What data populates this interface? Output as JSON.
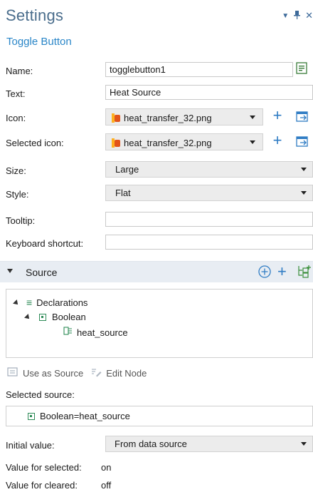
{
  "header": {
    "title": "Settings",
    "subtitle": "Toggle Button"
  },
  "window_controls": [
    "chevron-down-icon",
    "pin-icon",
    "close-icon"
  ],
  "fields": {
    "name": {
      "label": "Name:",
      "value": "togglebutton1"
    },
    "text": {
      "label": "Text:",
      "value": "Heat Source"
    },
    "icon": {
      "label": "Icon:",
      "value": "heat_transfer_32.png"
    },
    "selected_icon": {
      "label": "Selected icon:",
      "value": "heat_transfer_32.png"
    },
    "size": {
      "label": "Size:",
      "value": "Large"
    },
    "style": {
      "label": "Style:",
      "value": "Flat"
    },
    "tooltip": {
      "label": "Tooltip:",
      "value": ""
    },
    "keyboard_shortcut": {
      "label": "Keyboard shortcut:",
      "value": ""
    }
  },
  "source_section": {
    "title": "Source",
    "tree": {
      "root": "Declarations",
      "child": "Boolean",
      "leaf": "heat_source"
    },
    "toolbar": {
      "use_as_source": "Use as Source",
      "edit_node": "Edit Node"
    },
    "selected_source_label": "Selected source:",
    "selected_source_value": "Boolean=heat_source"
  },
  "initial_value": {
    "label": "Initial value:",
    "value": "From data source"
  },
  "value_selected": {
    "label": "Value for selected:",
    "value": "on"
  },
  "value_cleared": {
    "label": "Value for cleared:",
    "value": "off"
  },
  "colors": {
    "accent_blue": "#2f7cc4",
    "title_blue": "#4a6d8c",
    "section_bg": "#e8edf3"
  }
}
